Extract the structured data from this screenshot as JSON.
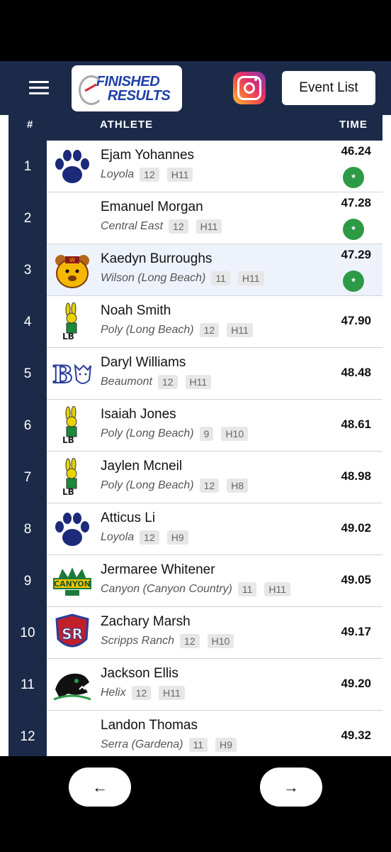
{
  "header": {
    "logo_line1": "FINISHED",
    "logo_line2": "RESULTS",
    "event_list_label": "Event List",
    "instagram_icon": "instagram-icon",
    "menu_icon": "hamburger-menu-icon",
    "colors": {
      "navy": "#1c2a4a",
      "qualifier_green": "#2d9b46"
    }
  },
  "table": {
    "columns": {
      "rank": "#",
      "athlete": "ATHLETE",
      "time": "TIME"
    },
    "rows": [
      {
        "rank": "1",
        "name": "Ejam Yohannes",
        "school": "Loyola",
        "grade": "12",
        "heat": "H11",
        "time": "46.24",
        "qualifier": "*",
        "logo": "paw-print-logo"
      },
      {
        "rank": "2",
        "name": "Emanuel Morgan",
        "school": "Central East",
        "grade": "12",
        "heat": "H11",
        "time": "47.28",
        "qualifier": "*",
        "logo": ""
      },
      {
        "rank": "3",
        "name": "Kaedyn Burroughs",
        "school": "Wilson (Long Beach)",
        "grade": "11",
        "heat": "H11",
        "time": "47.29",
        "qualifier": "*",
        "logo": "bear-mascot-logo"
      },
      {
        "rank": "4",
        "name": "Noah Smith",
        "school": "Poly (Long Beach)",
        "grade": "12",
        "heat": "H11",
        "time": "47.90",
        "qualifier": "",
        "logo": "jackrabbit-logo"
      },
      {
        "rank": "5",
        "name": "Daryl Williams",
        "school": "Beaumont",
        "grade": "12",
        "heat": "H11",
        "time": "48.48",
        "qualifier": "",
        "logo": "b-cougar-logo"
      },
      {
        "rank": "6",
        "name": "Isaiah Jones",
        "school": "Poly (Long Beach)",
        "grade": "9",
        "heat": "H10",
        "time": "48.61",
        "qualifier": "",
        "logo": "jackrabbit-logo"
      },
      {
        "rank": "7",
        "name": "Jaylen Mcneil",
        "school": "Poly (Long Beach)",
        "grade": "12",
        "heat": "H8",
        "time": "48.98",
        "qualifier": "",
        "logo": "jackrabbit-logo"
      },
      {
        "rank": "8",
        "name": "Atticus Li",
        "school": "Loyola",
        "grade": "12",
        "heat": "H9",
        "time": "49.02",
        "qualifier": "",
        "logo": "paw-print-logo"
      },
      {
        "rank": "9",
        "name": "Jermaree Whitener",
        "school": "Canyon (Canyon Country)",
        "grade": "11",
        "heat": "H11",
        "time": "49.05",
        "qualifier": "",
        "logo": "canyon-logo"
      },
      {
        "rank": "10",
        "name": "Zachary Marsh",
        "school": "Scripps Ranch",
        "grade": "12",
        "heat": "H10",
        "time": "49.17",
        "qualifier": "",
        "logo": "sr-shield-logo"
      },
      {
        "rank": "11",
        "name": "Jackson Ellis",
        "school": "Helix",
        "grade": "12",
        "heat": "H11",
        "time": "49.20",
        "qualifier": "",
        "logo": "panther-logo"
      },
      {
        "rank": "12",
        "name": "Landon Thomas",
        "school": "Serra (Gardena)",
        "grade": "11",
        "heat": "H9",
        "time": "49.32",
        "qualifier": "",
        "logo": ""
      }
    ]
  },
  "nav": {
    "prev_icon": "arrow-left-icon",
    "next_icon": "arrow-right-icon",
    "prev_glyph": "←",
    "next_glyph": "→"
  }
}
